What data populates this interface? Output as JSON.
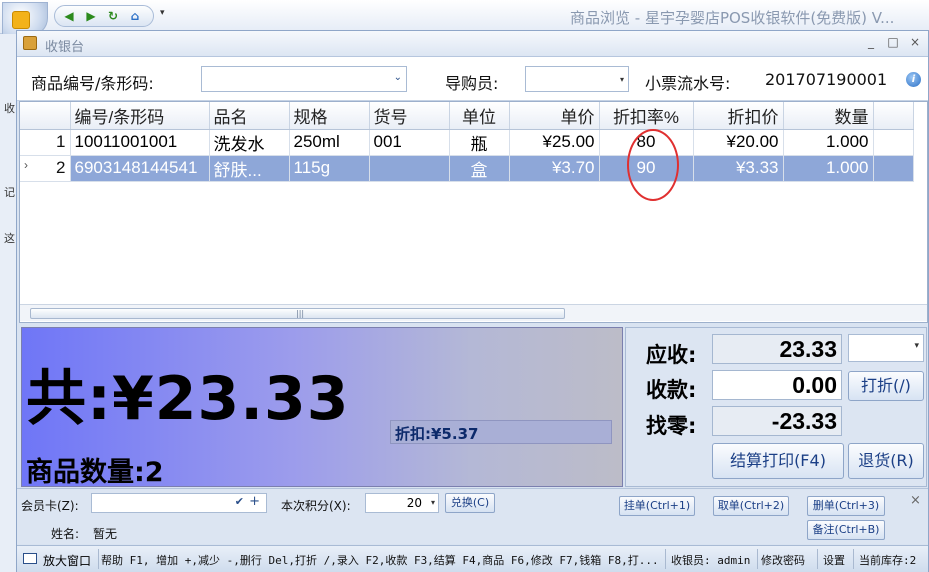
{
  "app": {
    "title": "商品浏览 - 星宇孕婴店POS收银软件(免费版) V...",
    "left_labels": [
      "收",
      "记",
      "这"
    ]
  },
  "dialog": {
    "title": "收银台",
    "win_buttons": [
      "_",
      "□",
      "×"
    ]
  },
  "form": {
    "barcode_label": "商品编号/条形码:",
    "barcode_value": "",
    "guide_label": "导购员:",
    "guide_value": "",
    "ticket_label": "小票流水号:",
    "ticket_value": "201707190001"
  },
  "grid": {
    "columns": [
      "编号/条形码",
      "品名",
      "规格",
      "货号",
      "单位",
      "单价",
      "折扣率%",
      "折扣价",
      "数量"
    ],
    "rows": [
      {
        "no": "1",
        "code": "10011001001",
        "name": "洗发水",
        "spec": "250ml",
        "item": "001",
        "unit": "瓶",
        "price": "¥25.00",
        "rate": "80",
        "disc_price": "¥20.00",
        "qty": "1.000"
      },
      {
        "no": "2",
        "code": "6903148144541",
        "name": "舒肤...",
        "spec": "115g",
        "item": "",
        "unit": "盒",
        "price": "¥3.70",
        "rate": "90",
        "disc_price": "¥3.33",
        "qty": "1.000"
      }
    ],
    "selected_indicator": "›",
    "scroll_grip": "|||"
  },
  "totals": {
    "total_text": "共:¥23.33",
    "discount_text": "折扣:¥5.37",
    "qty_text": "商品数量:2"
  },
  "payment": {
    "due_label": "应收:",
    "due_value": "23.33",
    "paid_label": "收款:",
    "paid_value": "0.00",
    "change_label": "找零:",
    "change_value": "-23.33",
    "discount_button": "打折(/)",
    "checkout_button": "结算打印(F4)",
    "return_button": "退货(R)"
  },
  "member": {
    "card_label": "会员卡(Z):",
    "card_value": "",
    "points_label": "本次积分(X):",
    "points_value": "20",
    "exchange_button": "兑换(C)",
    "name_label": "姓名:",
    "name_value": "暂无",
    "hold_button": "挂单(Ctrl+1)",
    "retrieve_button": "取单(Ctrl+2)",
    "delete_button": "删单(Ctrl+3)",
    "note_button": "备注(Ctrl+B)"
  },
  "statusbar": {
    "maximize_button": "放大窗口",
    "help_text": "帮助 F1, 增加 +,减少 -,删行 Del,打折 /,录入 F2,收款 F3,结算 F4,商品 F6,修改 F7,钱箱 F8,打...",
    "cashier_text": "收银员: admin",
    "change_password": "修改密码",
    "settings": "设置",
    "stock_text": "当前库存:2"
  },
  "colors": {
    "selected_row": "#8ea7d8",
    "panel_gradient_start": "#6f76f7",
    "highlight_oval": "#e03030"
  }
}
